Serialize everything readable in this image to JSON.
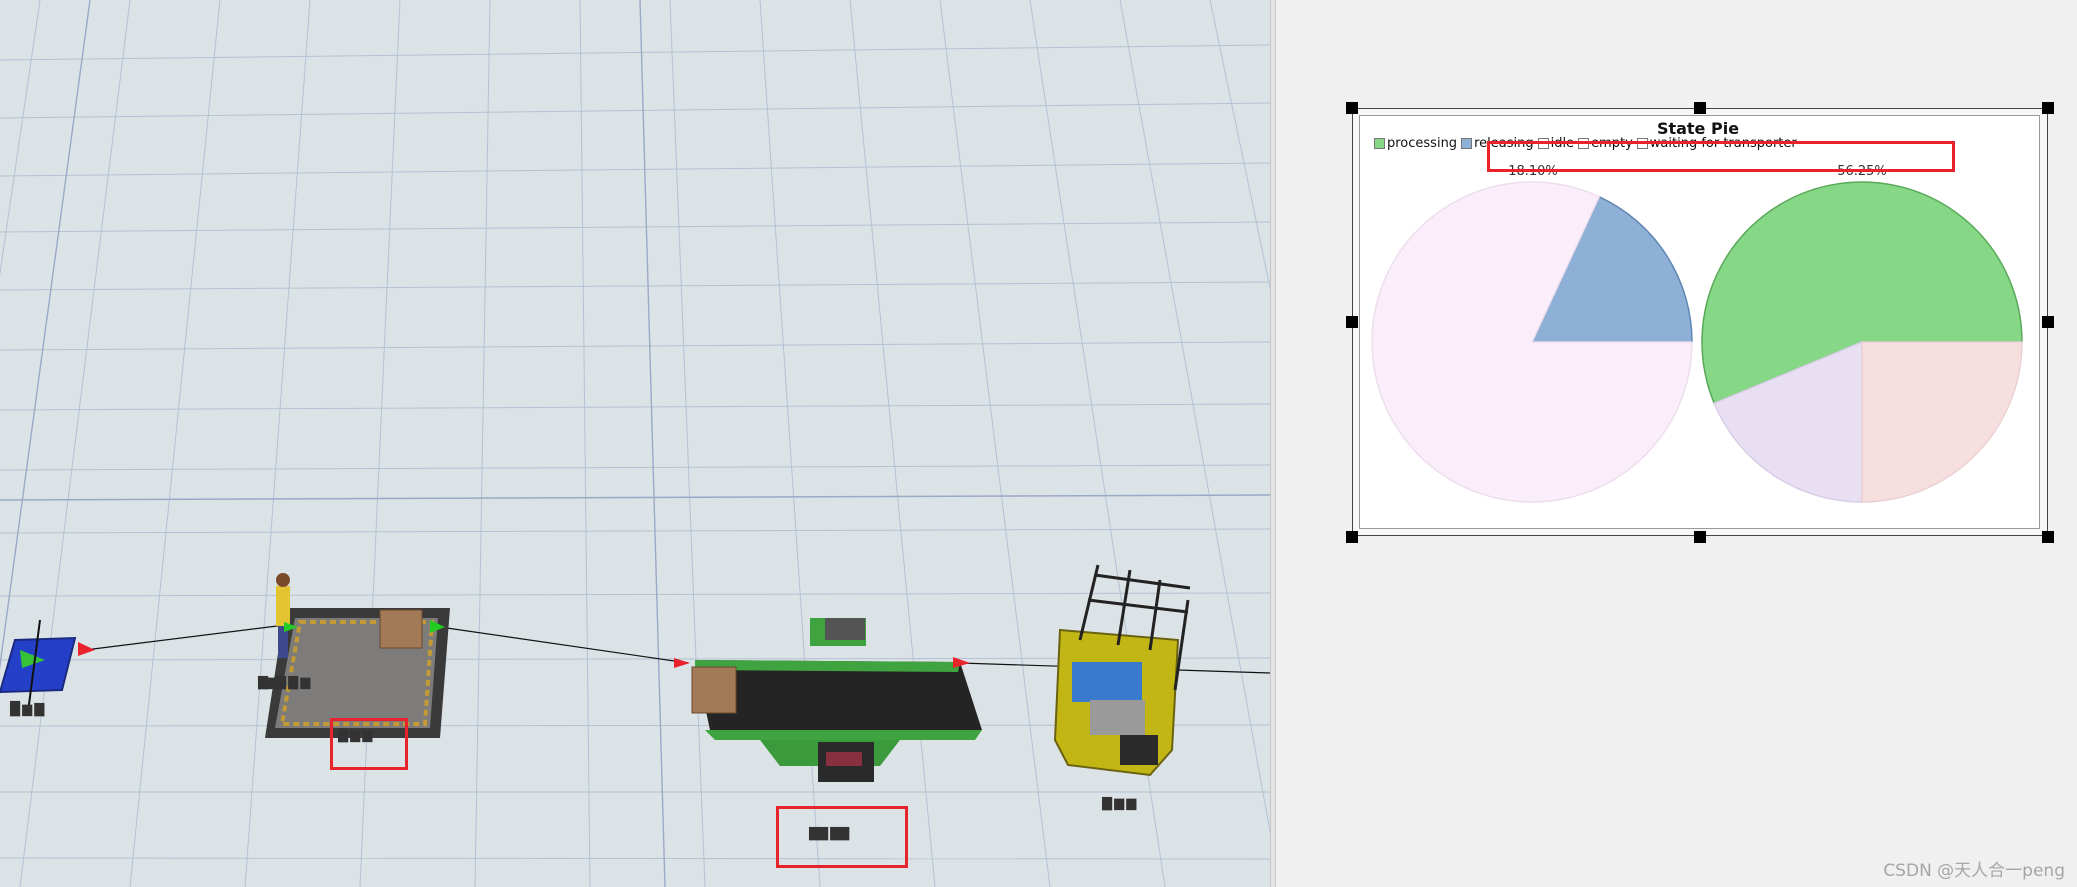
{
  "viewport": {
    "object_labels": {
      "source": "█ ▆ ▇",
      "queue": "▇▆▇ ▇ ▆",
      "queue_sub": "▇ ▆ ▆",
      "processor": "▇▇ ▇▇",
      "forklift": "▇ ▆ ▆"
    }
  },
  "chart": {
    "title": "State Pie",
    "legend": [
      {
        "label": "processing",
        "color": "#86d886"
      },
      {
        "label": "releasing",
        "color": "#8eb0d6"
      },
      {
        "label": "idle",
        "color": "#ffffff"
      },
      {
        "label": "empty",
        "color": "#ffffff"
      },
      {
        "label": "waiting for transporter",
        "color": "#ffffff"
      }
    ]
  },
  "chart_data": {
    "type": "pie",
    "title": "State Pie",
    "legend_position": "top-left",
    "pies": [
      {
        "label": "18.10%",
        "slices": [
          {
            "state": "releasing",
            "value": 18.1,
            "color": "#8eb0d6"
          },
          {
            "state": "empty",
            "value": 81.9,
            "color": "#faeefa"
          }
        ]
      },
      {
        "label": "56.25%",
        "slices": [
          {
            "state": "processing",
            "value": 56.25,
            "color": "#86d886"
          },
          {
            "state": "idle",
            "value": 18.75,
            "color": "#e8e0f2"
          },
          {
            "state": "empty",
            "value": 25.0,
            "color": "#f7dfe0"
          }
        ]
      }
    ]
  },
  "watermark": "CSDN @天人合一peng"
}
